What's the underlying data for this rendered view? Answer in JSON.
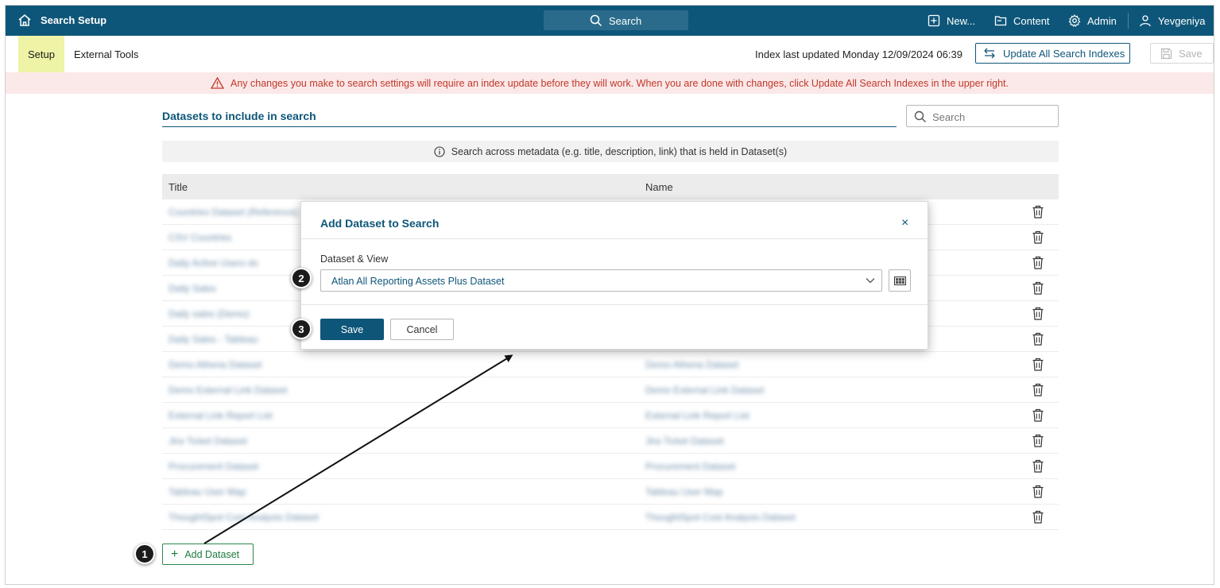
{
  "topbar": {
    "title": "Search Setup",
    "search_label": "Search",
    "new_label": "New...",
    "content_label": "Content",
    "admin_label": "Admin",
    "user_label": "Yevgeniya",
    "bg_color": "#0e5679"
  },
  "subheader": {
    "tab_setup": "Setup",
    "tab_external": "External Tools",
    "index_text": "Index last updated Monday 12/09/2024 06:39",
    "update_button": "Update All Search Indexes",
    "save_button": "Save"
  },
  "warning": {
    "text": "Any changes you make to search settings will require an index update before they will work. When you are done with changes, click Update All Search Indexes in the upper right."
  },
  "main": {
    "section_title": "Datasets to include in search",
    "search_placeholder": "Search",
    "info_text": "Search across metadata (e.g. title, description, link) that is held in Dataset(s)",
    "columns": {
      "title": "Title",
      "name": "Name"
    },
    "rows": [
      {
        "title": "Countries Dataset (Reference)",
        "name": ""
      },
      {
        "title": "CSV Countries",
        "name": ""
      },
      {
        "title": "Daily Active Users ds",
        "name": ""
      },
      {
        "title": "Daily Sales",
        "name": ""
      },
      {
        "title": "Daily sales (Demo)",
        "name": ""
      },
      {
        "title": "Daily Sales - Tableau",
        "name": ""
      },
      {
        "title": "Demo Athena Dataset",
        "name": "Demo Athena Dataset"
      },
      {
        "title": "Demo External Link Dataset",
        "name": "Demo External Link Dataset"
      },
      {
        "title": "External Link Report List",
        "name": "External Link Report List"
      },
      {
        "title": "Jira Ticket Dataset",
        "name": "Jira Ticket Dataset"
      },
      {
        "title": "Procurement Dataset",
        "name": "Procurement Dataset"
      },
      {
        "title": "Tableau User Map",
        "name": "Tableau User Map"
      },
      {
        "title": "ThoughtSpot Cost Analysis Dataset",
        "name": "ThoughtSpot Cost Analysis Dataset"
      }
    ],
    "add_button": "Add Dataset"
  },
  "modal": {
    "title": "Add Dataset to Search",
    "close_label": "×",
    "field_label": "Dataset & View",
    "selected_value": "Atlan All Reporting Assets Plus Dataset",
    "save_label": "Save",
    "cancel_label": "Cancel"
  },
  "steps": {
    "one": "1",
    "two": "2",
    "three": "3"
  }
}
